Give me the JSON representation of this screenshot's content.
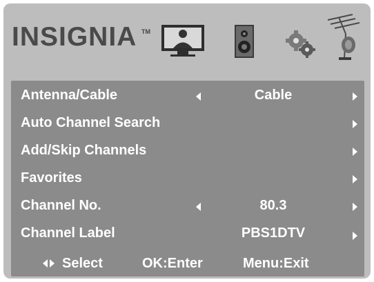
{
  "brand": {
    "name": "INSIGNIA",
    "tm": "TM"
  },
  "header": {
    "icons": [
      "tv-icon",
      "speaker-icon",
      "gears-icon",
      "antenna-icon"
    ]
  },
  "menu": {
    "rows": [
      {
        "label": "Antenna/Cable",
        "value": "Cable",
        "has_left_arrow": true
      },
      {
        "label": "Auto Channel Search",
        "value": "",
        "has_left_arrow": false
      },
      {
        "label": "Add/Skip Channels",
        "value": "",
        "has_left_arrow": false
      },
      {
        "label": "Favorites",
        "value": "",
        "has_left_arrow": false
      },
      {
        "label": "Channel No.",
        "value": "80.3",
        "has_left_arrow": true
      },
      {
        "label": "Channel Label",
        "value": "PBS1DTV",
        "has_left_arrow": false
      }
    ]
  },
  "footer": {
    "select": "Select",
    "ok": "OK:Enter",
    "menu": "Menu:Exit"
  },
  "colors": {
    "frame": "#bdbdbd",
    "menu_bg": "#8b8b8b",
    "text": "#ffffff",
    "logo": "#4a4a4a"
  }
}
